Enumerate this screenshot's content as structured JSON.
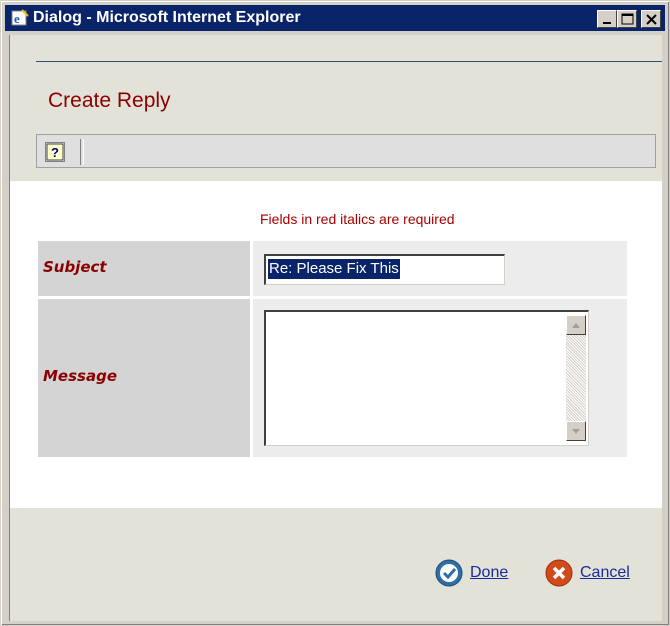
{
  "window": {
    "title": "Dialog - Microsoft Internet Explorer",
    "controls": [
      "minimize",
      "maximize",
      "close"
    ]
  },
  "header": {
    "title": "Create Reply"
  },
  "toolbar": {
    "help_icon": "help-icon"
  },
  "form": {
    "required_note": "Fields in red italics are required",
    "subject_label": "Subject",
    "subject_value": "Re: Please Fix This",
    "message_label": "Message",
    "message_value": ""
  },
  "footer": {
    "done_label": "Done",
    "cancel_label": "Cancel"
  },
  "colors": {
    "titlebar": "#0a246a",
    "required_text": "#a80000",
    "header_bg": "#e2e2d9",
    "link": "#1a2a9a"
  }
}
